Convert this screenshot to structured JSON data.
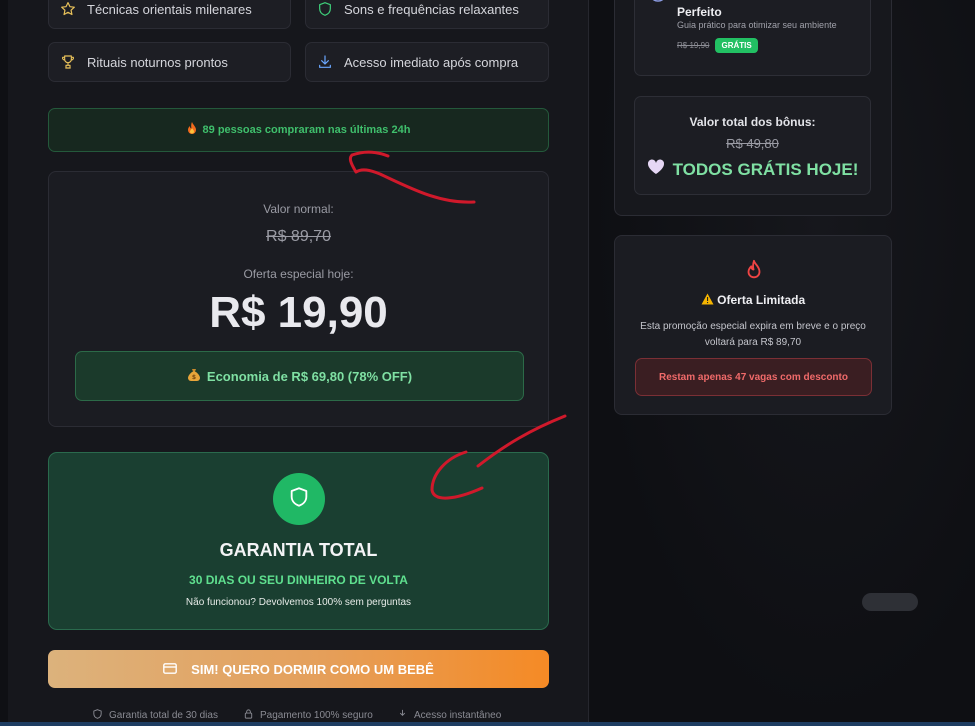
{
  "features": [
    {
      "icon": "star-icon",
      "label": "Técnicas orientais milenares"
    },
    {
      "icon": "shield-icon",
      "label": "Sons e frequências relaxantes"
    },
    {
      "icon": "trophy-icon",
      "label": "Rituais noturnos prontos"
    },
    {
      "icon": "download-icon",
      "label": "Acesso imediato após compra"
    }
  ],
  "social_proof": {
    "icon": "fire-icon",
    "text": "89 pessoas compraram nas últimas 24h"
  },
  "pricing": {
    "normal_label": "Valor normal:",
    "normal_price": "R$ 89,70",
    "offer_label": "Oferta especial hoje:",
    "offer_price": "R$ 19,90",
    "savings_icon": "money-bag-icon",
    "savings_text": "Economia de R$ 69,80 (78% OFF)"
  },
  "guarantee": {
    "title": "GARANTIA TOTAL",
    "subtitle": "30 DIAS OU SEU DINHEIRO DE VOLTA",
    "note": "Não funcionou? Devolvemos 100% sem perguntas"
  },
  "cta": {
    "label": "SIM! QUERO DORMIR COMO UM BEBÊ"
  },
  "trust": [
    "Garantia total de 30 dias",
    "Pagamento 100% seguro",
    "Acesso instantâneo"
  ],
  "bonus": {
    "item_title": "Perfeito",
    "item_desc": "Guia prático para otimizar seu ambiente",
    "item_old_price": "R$ 19,90",
    "item_badge": "GRÁTIS",
    "total_label": "Valor total dos bônus:",
    "total_old": "R$ 49,80",
    "total_free": "TODOS GRÁTIS HOJE!",
    "free_icon": "heart-icon"
  },
  "offer": {
    "icon": "fire-icon",
    "title": "Oferta Limitada",
    "warning_icon": "warning-icon",
    "text": "Esta promoção especial expira em breve e o preço voltará para R$ 89,70",
    "button": "Restam apenas 47 vagas com desconto"
  },
  "colors": {
    "accent_green": "#20b865",
    "cta_start": "#dcb27c",
    "cta_end": "#f58a25",
    "danger": "#f06a6a"
  }
}
